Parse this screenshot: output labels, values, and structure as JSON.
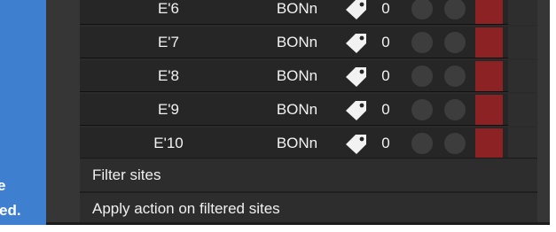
{
  "sidebar": {
    "text_line1": "e",
    "text_line2": "ed."
  },
  "sites": [
    {
      "name": "E'6",
      "type": "BONn",
      "count": "0"
    },
    {
      "name": "E'7",
      "type": "BONn",
      "count": "0"
    },
    {
      "name": "E'8",
      "type": "BONn",
      "count": "0"
    },
    {
      "name": "E'9",
      "type": "BONn",
      "count": "0"
    },
    {
      "name": "E'10",
      "type": "BONn",
      "count": "0"
    }
  ],
  "menu": {
    "filter_label": "Filter sites",
    "apply_label": "Apply action on filtered sites"
  },
  "icons": {
    "tag": "tag-icon"
  },
  "colors": {
    "accent_blue": "#3e7fcf",
    "status_red": "#8c2223",
    "background": "#2b2b2b"
  }
}
